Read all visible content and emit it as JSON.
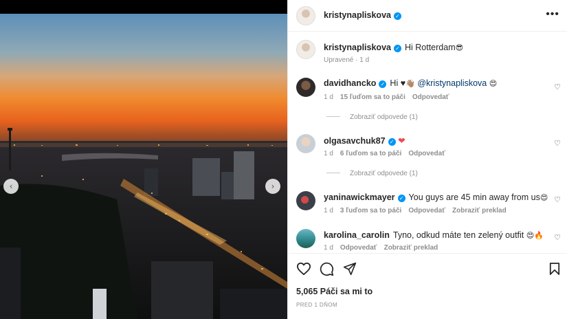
{
  "post": {
    "author": "kristynapliskova",
    "more_icon": "more-options-icon",
    "caption": "Hi Rotterdam",
    "caption_emoji": "😎",
    "edited": "Upravené",
    "age": "1 d"
  },
  "comments": [
    {
      "username": "davidhancko",
      "verified": true,
      "text_prefix": "Hi ♥",
      "text_emoji": "👋🏽",
      "mention": "@kristynapliskova",
      "text_suffix": "😍",
      "age": "1 d",
      "likes": "15 ľuďom sa to páči",
      "reply": "Odpovedať",
      "view_replies": "Zobraziť odpovede (1)"
    },
    {
      "username": "olgasavchuk87",
      "verified": true,
      "text": "❤",
      "age": "1 d",
      "likes": "6 ľuďom sa to páči",
      "reply": "Odpovedať",
      "view_replies": "Zobraziť odpovede (1)"
    },
    {
      "username": "yaninawickmayer",
      "verified": true,
      "text": "You guys are 45 min away from us",
      "text_emoji": "😍",
      "age": "1 d",
      "likes": "3 ľuďom sa to páči",
      "reply": "Odpovedať",
      "translate": "Zobraziť preklad"
    },
    {
      "username": "karolina_carolin",
      "verified": false,
      "text": "Tyno, odkud máte ten zelený outfit",
      "text_emoji": "😍🔥",
      "age": "1 d",
      "reply": "Odpovedať",
      "translate": "Zobraziť preklad"
    }
  ],
  "actions": {
    "like_icon": "heart-icon",
    "comment_icon": "comment-icon",
    "share_icon": "share-icon",
    "save_icon": "bookmark-icon",
    "likes": "5,065 Páči sa mi to",
    "date": "PRED 1 DŇOM"
  },
  "carousel": {
    "prev_icon": "chevron-left-icon",
    "next_icon": "chevron-right-icon",
    "prev_glyph": "‹",
    "next_glyph": "›"
  },
  "colors": {
    "verified": "#0095f6",
    "link": "#00376b",
    "muted": "#8e8e8e",
    "text": "#262626",
    "heart_red": "#ed4956"
  }
}
